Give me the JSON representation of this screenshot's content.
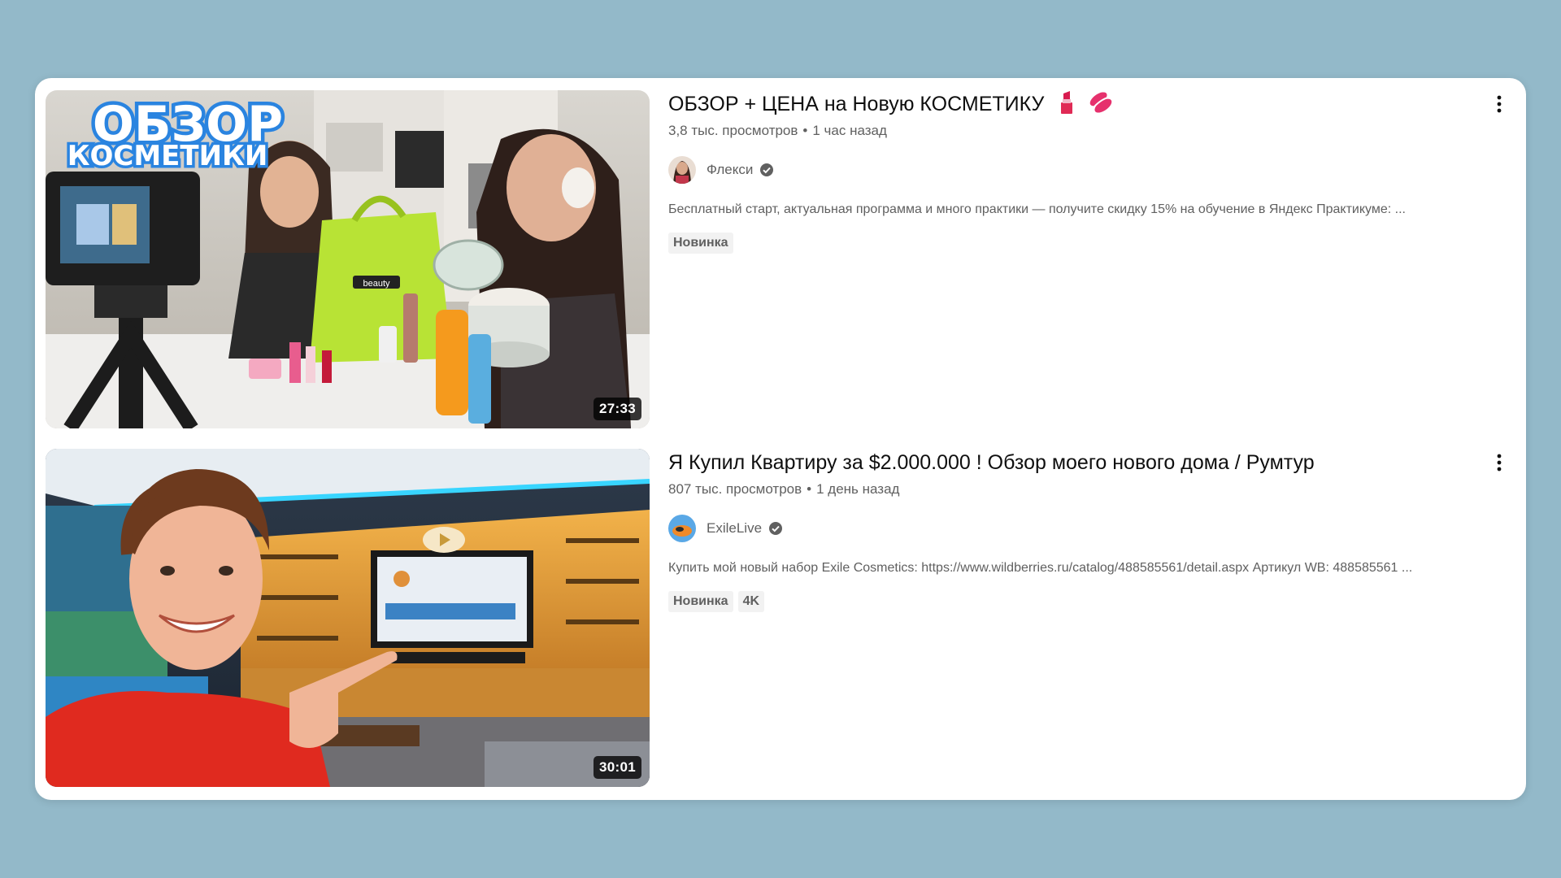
{
  "results": [
    {
      "title": "ОБЗОР + ЦЕНА на Новую КОСМЕТИКУ",
      "title_emojis": [
        "lipstick-emoji",
        "kiss-mark-emoji"
      ],
      "views": "3,8 тыс. просмотров",
      "separator": "•",
      "age": "1 час назад",
      "channel": "Флекси",
      "verified": true,
      "description": "Бесплатный старт, актуальная программа и много практики — получите скидку 15% на обучение в Яндекс Практикуме: ...",
      "badges": [
        "Новинка"
      ],
      "duration": "27:33",
      "thumbnail_text": [
        "ОБЗОР",
        "КОСМЕТИКИ"
      ],
      "thumbnail_bag_label": "beauty"
    },
    {
      "title": "Я Купил Квартиру за $2.000.000 ! Обзор моего нового дома / Румтур",
      "views": "807 тыс. просмотров",
      "separator": "•",
      "age": "1 день назад",
      "channel": "ExileLive",
      "verified": true,
      "description": "Купить мой новый набор Exile Cosmetics: https://www.wildberries.ru/catalog/488585561/detail.aspx Артикул WB: 488585561 ...",
      "badges": [
        "Новинка",
        "4K"
      ],
      "duration": "30:01"
    }
  ],
  "colors": {
    "page_background": "#93b9c9",
    "card_background": "#ffffff",
    "title_text": "#0f0f0f",
    "meta_text": "#606060",
    "badge_background": "#f2f2f2"
  },
  "icons": {
    "menu": "more-vert-icon",
    "verified": "verified-check-icon"
  }
}
